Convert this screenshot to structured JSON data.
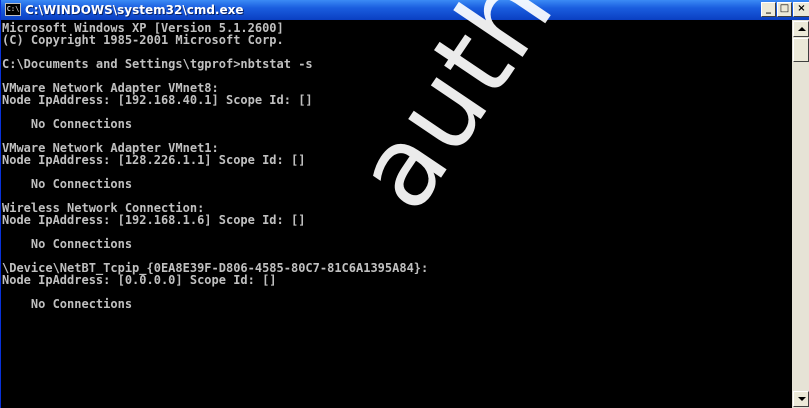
{
  "window": {
    "icon_label": "C:\\",
    "title": "C:\\WINDOWS\\system32\\cmd.exe",
    "minimize_glyph": "_",
    "maximize_glyph": "□",
    "close_glyph": "×"
  },
  "console": {
    "lines": [
      "Microsoft Windows XP [Version 5.1.2600]",
      "(C) Copyright 1985-2001 Microsoft Corp.",
      "",
      "C:\\Documents and Settings\\tgprof>nbtstat -s",
      "",
      "VMware Network Adapter VMnet8:",
      "Node IpAddress: [192.168.40.1] Scope Id: []",
      "",
      "    No Connections",
      "",
      "VMware Network Adapter VMnet1:",
      "Node IpAddress: [128.226.1.1] Scope Id: []",
      "",
      "    No Connections",
      "",
      "Wireless Network Connection:",
      "Node IpAddress: [192.168.1.6] Scope Id: []",
      "",
      "    No Connections",
      "",
      "\\Device\\NetBT_Tcpip_{0EA8E39F-D806-4585-80C7-81C6A1395A84}:",
      "Node IpAddress: [0.0.0.0] Scope Id: []",
      "",
      "    No Connections"
    ]
  },
  "watermark": {
    "text": "author retains"
  }
}
